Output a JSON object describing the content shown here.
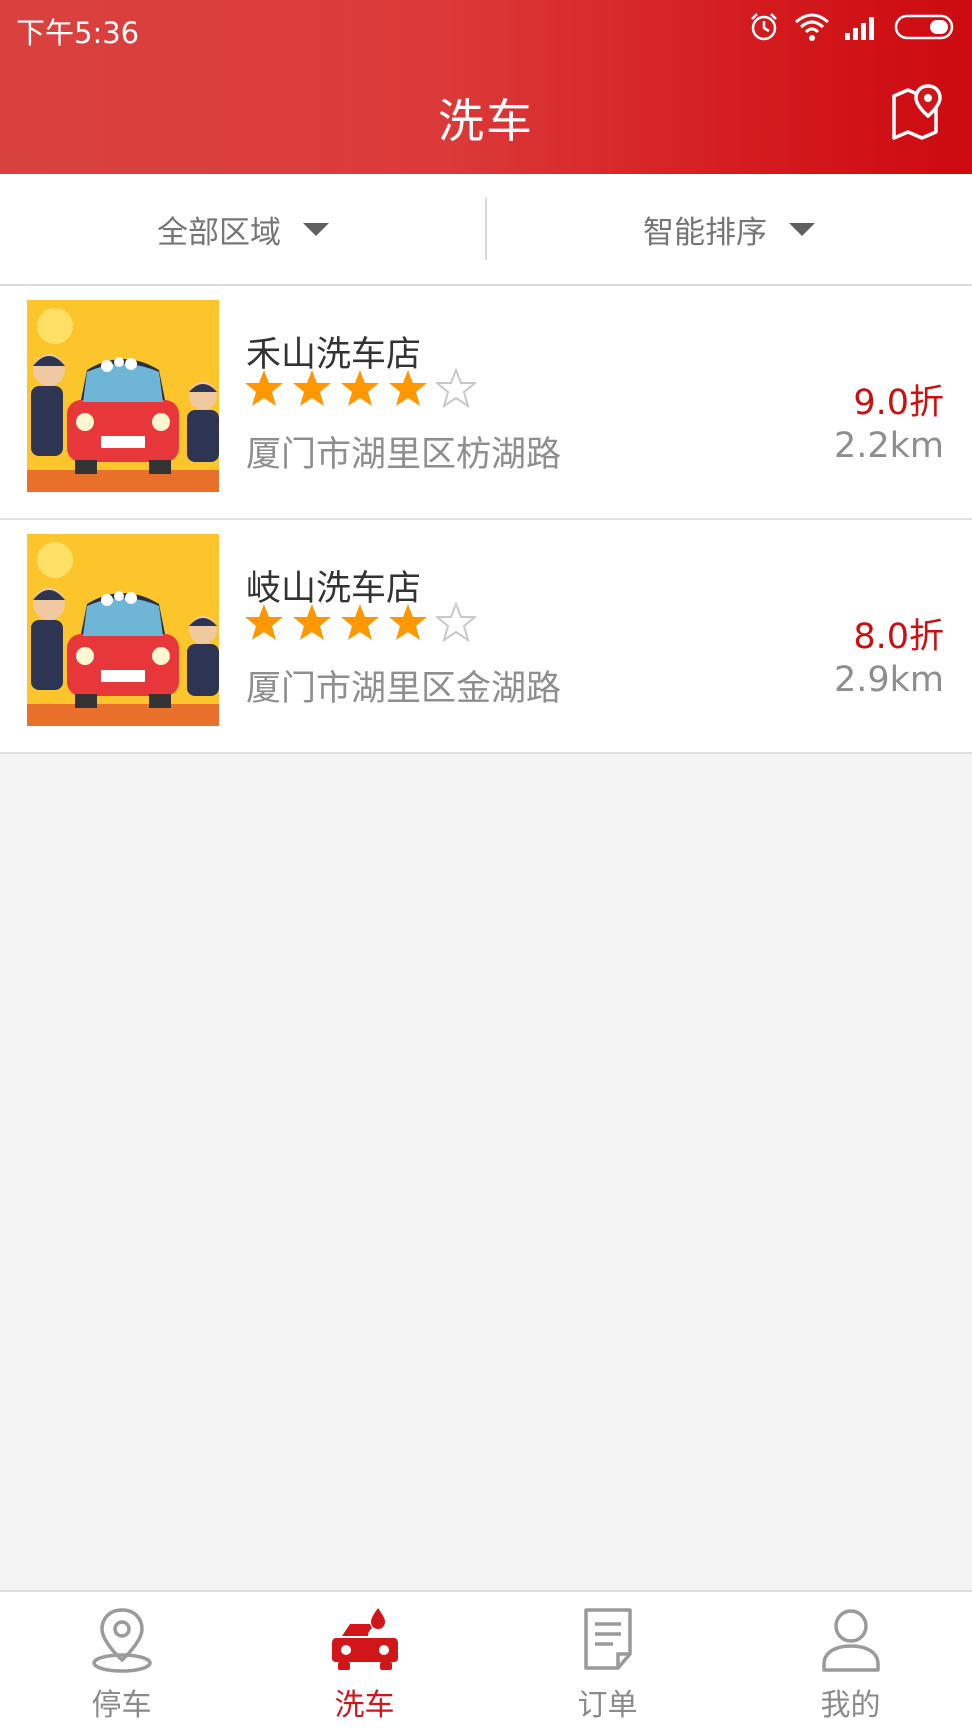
{
  "status_bar": {
    "time": "下午5:36"
  },
  "header": {
    "title": "洗车",
    "map_icon": "map-pin-icon"
  },
  "filters": [
    {
      "label": "全部区域"
    },
    {
      "label": "智能排序"
    }
  ],
  "shops": [
    {
      "name": "禾山洗车店",
      "rating": 4,
      "address": "厦门市湖里区枋湖路",
      "discount": "9.0折",
      "distance": "2.2km"
    },
    {
      "name": "岐山洗车店",
      "rating": 4,
      "address": "厦门市湖里区金湖路",
      "discount": "8.0折",
      "distance": "2.9km"
    }
  ],
  "tabs": [
    {
      "label": "停车",
      "icon": "location-pin-icon",
      "active": false
    },
    {
      "label": "洗车",
      "icon": "car-wash-icon",
      "active": true
    },
    {
      "label": "订单",
      "icon": "document-icon",
      "active": false
    },
    {
      "label": "我的",
      "icon": "user-icon",
      "active": false
    }
  ],
  "colors": {
    "brand_red": "#d11519",
    "star": "#ff9800",
    "gray_text": "#8e8e8e"
  }
}
